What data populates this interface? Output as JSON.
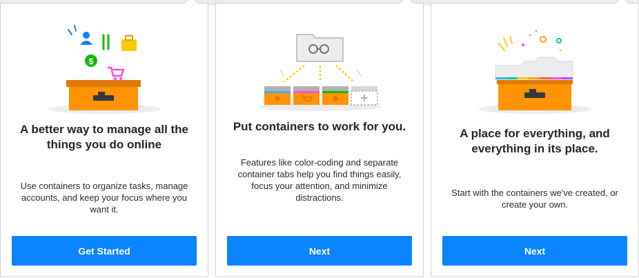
{
  "colors": {
    "accent": "#0a84ff",
    "box_orange": "#ff9400",
    "box_dark": "#e0790a",
    "tab_colors": [
      "#37adff",
      "#00c79a",
      "#ffcb00",
      "#ff9f00",
      "#ff613d",
      "#ff4bda",
      "#af51f5"
    ]
  },
  "panels": [
    {
      "title": "A better way to manage all the things you do online",
      "description": "Use containers to organize tasks, manage accounts, and keep your focus where you want it.",
      "button_label": "Get Started",
      "illustration_icons": [
        "person-icon",
        "fork-knife-icon",
        "briefcase-icon",
        "dollar-icon",
        "shopping-cart-icon"
      ]
    },
    {
      "title": "Put containers to work for you.",
      "description": "Features like color-coding and separate container tabs help you find things easily, focus your attention, and minimize distractions.",
      "button_label": "Next",
      "illustration_icons": [
        "glasses-icon",
        "fingerprint-icon",
        "cart-icon",
        "dollar-icon",
        "plus-icon"
      ]
    },
    {
      "title": "A place for everything, and everything in its place.",
      "description": "Start with the containers we've created, or create your own.",
      "button_label": "Next",
      "illustration_icons": [
        "container-box-icon"
      ]
    }
  ]
}
